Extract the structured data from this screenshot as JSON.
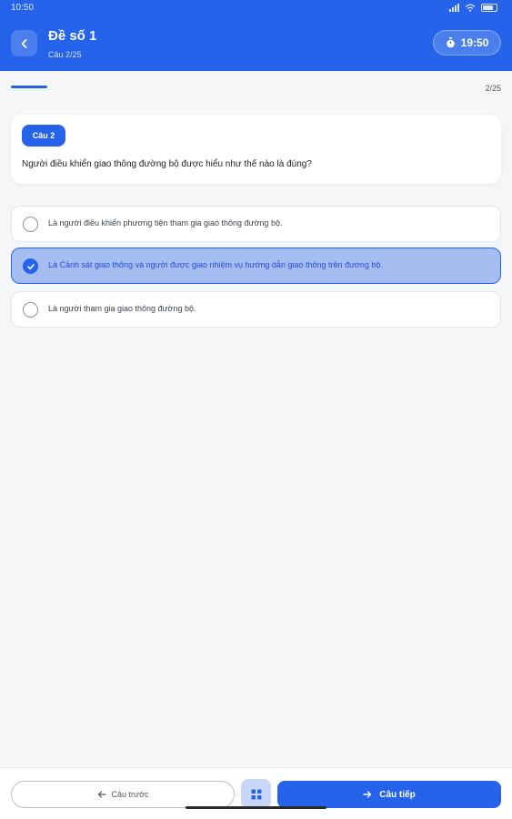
{
  "status_bar": {
    "time": "10:50"
  },
  "header": {
    "title": "Đề số 1",
    "subtitle": "Câu 2/25",
    "timer": "19:50",
    "back_icon": "chevron-left-icon",
    "timer_icon": "stopwatch-icon"
  },
  "progress": {
    "count": "2/25",
    "fraction": 0.08
  },
  "question": {
    "badge": "Câu 2",
    "text": "Người điều khiển giao thông đường bộ được hiểu như thế nào là đúng?"
  },
  "options": [
    {
      "text": "Là người điều khiển phương tiện tham gia giao thông đường bộ.",
      "selected": false
    },
    {
      "text": "Là Cảnh sát giao thông và người được giao nhiệm vụ hướng dẫn giao thông trên đường bộ.",
      "selected": true
    },
    {
      "text": "Là người tham gia giao thông đường bộ.",
      "selected": false
    }
  ],
  "footer": {
    "prev_label": "Câu trước",
    "next_label": "Câu tiếp",
    "grid_icon": "grid-icon"
  },
  "colors": {
    "accent": "#2563eb",
    "selected_bg": "#a6bdf2"
  }
}
